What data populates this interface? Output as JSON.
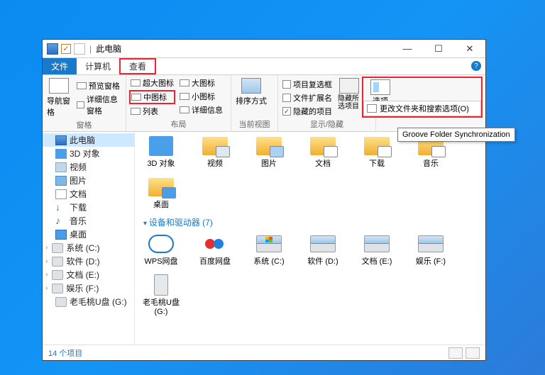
{
  "window": {
    "title": "此电脑"
  },
  "window_controls": {
    "min": "—",
    "max": "☐",
    "close": "✕"
  },
  "tabs": {
    "file": "文件",
    "computer": "计算机",
    "view": "查看"
  },
  "ribbon": {
    "panes": {
      "label": "窗格",
      "nav": "导航窗格",
      "preview": "预览窗格",
      "details": "详细信息窗格"
    },
    "layout": {
      "label": "布局",
      "items": {
        "extra_large": "超大图标",
        "large": "大图标",
        "medium": "中图标",
        "small": "小图标",
        "list": "列表",
        "details": "详细信息"
      }
    },
    "current_view": {
      "label": "当前视图",
      "sort": "排序方式"
    },
    "show_hide": {
      "label": "显示/隐藏",
      "item_checkboxes": "项目复选框",
      "filename_ext": "文件扩展名",
      "hidden_items": "隐藏的项目",
      "hide_selected": "隐藏所选项目"
    },
    "options": {
      "btn": "选项",
      "menu": "更改文件夹和搜索选项(O)"
    }
  },
  "tooltip": "Groove Folder Synchronization",
  "sidebar": [
    {
      "label": "此电脑",
      "icon": "pc",
      "active": true
    },
    {
      "label": "3D 对象",
      "icon": "3d"
    },
    {
      "label": "视频",
      "icon": "vid"
    },
    {
      "label": "图片",
      "icon": "pic"
    },
    {
      "label": "文档",
      "icon": "doc"
    },
    {
      "label": "下载",
      "icon": "dl"
    },
    {
      "label": "音乐",
      "icon": "mus"
    },
    {
      "label": "桌面",
      "icon": "desk"
    },
    {
      "label": "系统 (C:)",
      "icon": "drv",
      "expand": true
    },
    {
      "label": "软件 (D:)",
      "icon": "drv",
      "expand": true
    },
    {
      "label": "文档 (E:)",
      "icon": "drv",
      "expand": true
    },
    {
      "label": "娱乐 (F:)",
      "icon": "drv",
      "expand": true
    },
    {
      "label": "老毛桃U盘 (G:)",
      "icon": "drv"
    }
  ],
  "folders_row": [
    {
      "label": "3D 对象",
      "icon": "3d"
    },
    {
      "label": "视频",
      "icon": "vid"
    },
    {
      "label": "图片",
      "icon": "pic"
    },
    {
      "label": "文档",
      "icon": "doc"
    },
    {
      "label": "下载",
      "icon": "dl"
    },
    {
      "label": "音乐",
      "icon": "mus"
    },
    {
      "label": "桌面",
      "icon": "desk"
    }
  ],
  "devices_header": "设备和驱动器 (7)",
  "devices_row": [
    {
      "label": "WPS网盘",
      "icon": "cloud"
    },
    {
      "label": "百度网盘",
      "icon": "cloud2"
    },
    {
      "label": "系统 (C:)",
      "icon": "drivewin"
    },
    {
      "label": "软件 (D:)",
      "icon": "drive"
    },
    {
      "label": "文档 (E:)",
      "icon": "drive"
    },
    {
      "label": "娱乐 (F:)",
      "icon": "drive"
    },
    {
      "label": "老毛桃U盘 (G:)",
      "icon": "tower"
    }
  ],
  "status": "14 个项目"
}
